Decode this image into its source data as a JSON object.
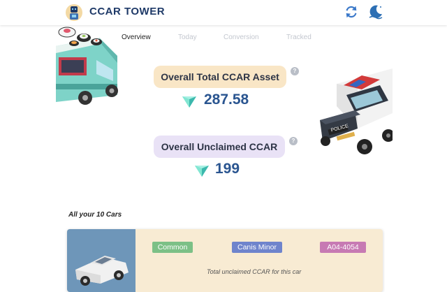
{
  "app": {
    "title": "CCAR TOWER"
  },
  "tabs": [
    {
      "label": "Overview",
      "active": true
    },
    {
      "label": "Today",
      "active": false
    },
    {
      "label": "Conversion",
      "active": false
    },
    {
      "label": "Tracked",
      "active": false
    }
  ],
  "stats": {
    "asset": {
      "label": "Overall Total CCAR Asset",
      "value": "287.58"
    },
    "unclaimed": {
      "label": "Overall Unclaimed CCAR",
      "value": "199"
    },
    "help_glyph": "?"
  },
  "cars": {
    "heading": "All your 10 Cars",
    "items": [
      {
        "rarity": "Common",
        "constellation": "Canis Minor",
        "plate": "A04-4054",
        "unclaimed_label": "Total unclaimed CCAR for this car"
      }
    ]
  },
  "icons": {
    "logo": "robot-logo-icon",
    "refresh": "refresh-icon",
    "theme": "moon-theme-icon",
    "gem": "diamond-gem-icon"
  },
  "colors": {
    "accent": "#2a5590",
    "asset_pill": "#f9e6c6",
    "unclaimed_pill": "#e9e2f6",
    "card_bg": "#f8ebd3"
  }
}
